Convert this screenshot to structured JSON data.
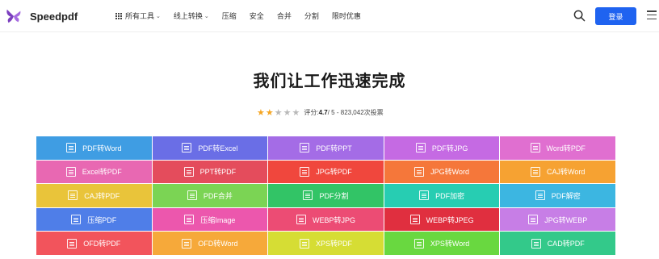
{
  "brand": {
    "name": "Speedpdf",
    "accent": "#1f63f0",
    "logo_color": "#7b3fbf"
  },
  "nav": {
    "items": [
      {
        "label": "所有工具",
        "icon": "grid-icon",
        "dropdown": true
      },
      {
        "label": "线上转换",
        "dropdown": true
      },
      {
        "label": "压缩"
      },
      {
        "label": "安全"
      },
      {
        "label": "合并"
      },
      {
        "label": "分割"
      },
      {
        "label": "限时优惠"
      }
    ],
    "login_label": "登录"
  },
  "hero": {
    "title": "我们让工作迅速完成",
    "rating": {
      "stars_filled": 2,
      "stars_total": 5,
      "label": "评分: ",
      "score": "4.7",
      "rest": " / 5 - 823,042次投票"
    }
  },
  "tools": [
    {
      "label": "PDF转Word",
      "color": "#3f9de3"
    },
    {
      "label": "PDF转Excel",
      "color": "#6a6ee6"
    },
    {
      "label": "PDF转PPT",
      "color": "#a46ce6"
    },
    {
      "label": "PDF转JPG",
      "color": "#c56ae3"
    },
    {
      "label": "Word转PDF",
      "color": "#e06fd0"
    },
    {
      "label": "Excel转PDF",
      "color": "#e868b2"
    },
    {
      "label": "PPT转PDF",
      "color": "#e44c5c"
    },
    {
      "label": "JPG转PDF",
      "color": "#f0473d"
    },
    {
      "label": "JPG转Word",
      "color": "#f5773a"
    },
    {
      "label": "CAJ转Word",
      "color": "#f6a232"
    },
    {
      "label": "CAJ转PDF",
      "color": "#e9c43a"
    },
    {
      "label": "PDF合并",
      "color": "#7bd454"
    },
    {
      "label": "PDF分割",
      "color": "#32c466"
    },
    {
      "label": "PDF加密",
      "color": "#27cdb2"
    },
    {
      "label": "PDF解密",
      "color": "#3cb6e1"
    },
    {
      "label": "压缩PDF",
      "color": "#4f7ee8"
    },
    {
      "label": "压缩Image",
      "color": "#ec57ad"
    },
    {
      "label": "WEBP转JPG",
      "color": "#ec4c74"
    },
    {
      "label": "WEBP转JPEG",
      "color": "#e02f3f"
    },
    {
      "label": "JPG转WEBP",
      "color": "#c77ee6"
    },
    {
      "label": "OFD转PDF",
      "color": "#f2545c"
    },
    {
      "label": "OFD转Word",
      "color": "#f6a93a"
    },
    {
      "label": "XPS转PDF",
      "color": "#d6dd34"
    },
    {
      "label": "XPS转Word",
      "color": "#69d840"
    },
    {
      "label": "CAD转PDF",
      "color": "#33c98a"
    }
  ]
}
